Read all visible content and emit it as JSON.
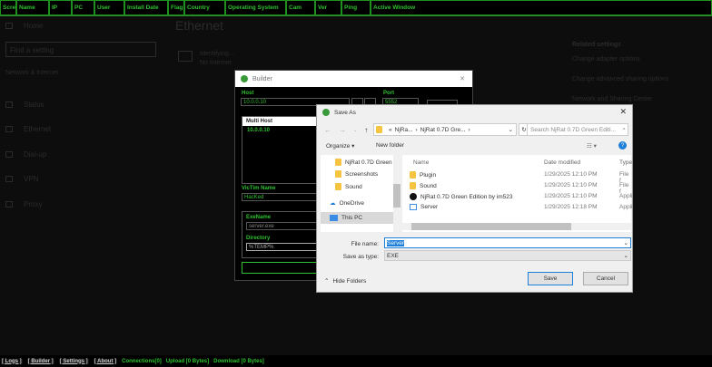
{
  "columns": [
    "Scre",
    "Name",
    "IP",
    "PC",
    "User",
    "Install Date",
    "Flag",
    "Country",
    "Operating System",
    "Cam",
    "Ver",
    "Ping",
    "Active Window"
  ],
  "settings": {
    "home": "Home",
    "search_placeholder": "Find a setting",
    "section": "Network & Internet",
    "items": [
      "Status",
      "Ethernet",
      "Dial-up",
      "VPN",
      "Proxy"
    ],
    "title": "Ethernet",
    "net_name": "Identifying...",
    "net_status": "No Internet",
    "related": "Related settings",
    "links": [
      "Change adapter options",
      "Change advanced sharing options",
      "Network and Sharing Center"
    ]
  },
  "builder": {
    "title": "Builder",
    "host_label": "Host",
    "host": "10.0.0.10",
    "port_label": "Port",
    "port": "5552",
    "multi_host_label": "Multi Host",
    "multi_hosts": [
      "10.0.0.10"
    ],
    "victim_label": "VicTim Name",
    "victim": "HacKed",
    "exe_label": "ExeName",
    "exe": "server.exe",
    "dir_label": "Directory",
    "dir": "%TEMP%"
  },
  "saveas": {
    "title": "Save As",
    "path": [
      "«",
      "NjRa...",
      "›",
      "NjRat 0.7D Gre...",
      "›"
    ],
    "search_placeholder": "Search NjRat 0.7D Green Editi...",
    "organize": "Organize ▾",
    "new_folder": "New folder",
    "tree": [
      "NjRat 0.7D Green",
      "Screenshots",
      "Sound",
      "OneDrive",
      "This PC"
    ],
    "headers": [
      "Name",
      "Date modified",
      "Type"
    ],
    "files": [
      {
        "name": "Plugin",
        "date": "1/29/2025 12:10 PM",
        "type": "File f"
      },
      {
        "name": "Sound",
        "date": "1/29/2025 12:10 PM",
        "type": "File f"
      },
      {
        "name": "NjRat 0.7D Green Edition by im523",
        "date": "1/29/2025 12:10 PM",
        "type": "Appli"
      },
      {
        "name": "Server",
        "date": "1/29/2025 12:18 PM",
        "type": "Appli"
      }
    ],
    "file_name_label": "File name:",
    "file_name": "Server",
    "type_label": "Save as type:",
    "type": "EXE",
    "hide_folders": "Hide Folders",
    "save": "Save",
    "cancel": "Cancel"
  },
  "status": {
    "links": [
      "[ Logs ]",
      "[ Builder ]",
      "[ Settings ]",
      "[ About ]"
    ],
    "connections": "Connections[0]",
    "upload": "Upload [0 Bytes]",
    "download": "Download [0 Bytes]"
  }
}
